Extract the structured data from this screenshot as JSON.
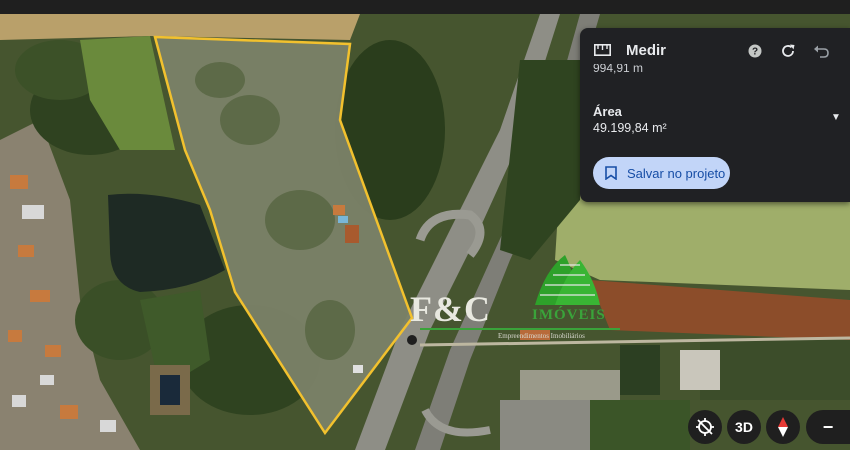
{
  "panel": {
    "title": "Medir",
    "distance_cut": "994,91 m",
    "area_label": "Área",
    "area_value": "49.199,84 m²",
    "save_label": "Salvar no projeto"
  },
  "controls": {
    "three_d_label": "3D",
    "zoom_out_label": "−"
  },
  "watermark": {
    "brand": "F&C",
    "word": "IMÓVEIS",
    "tagline": "Empreendimentos Imobiliários"
  },
  "colors": {
    "polygon": "#f2c12e",
    "accent": "#c2d5f8",
    "panel_bg": "#202124"
  },
  "icons": [
    "ruler-icon",
    "help-icon",
    "refresh-icon",
    "undo-icon",
    "chevron-down-icon",
    "bookmark-icon",
    "compass-off-icon",
    "compass-icon"
  ]
}
